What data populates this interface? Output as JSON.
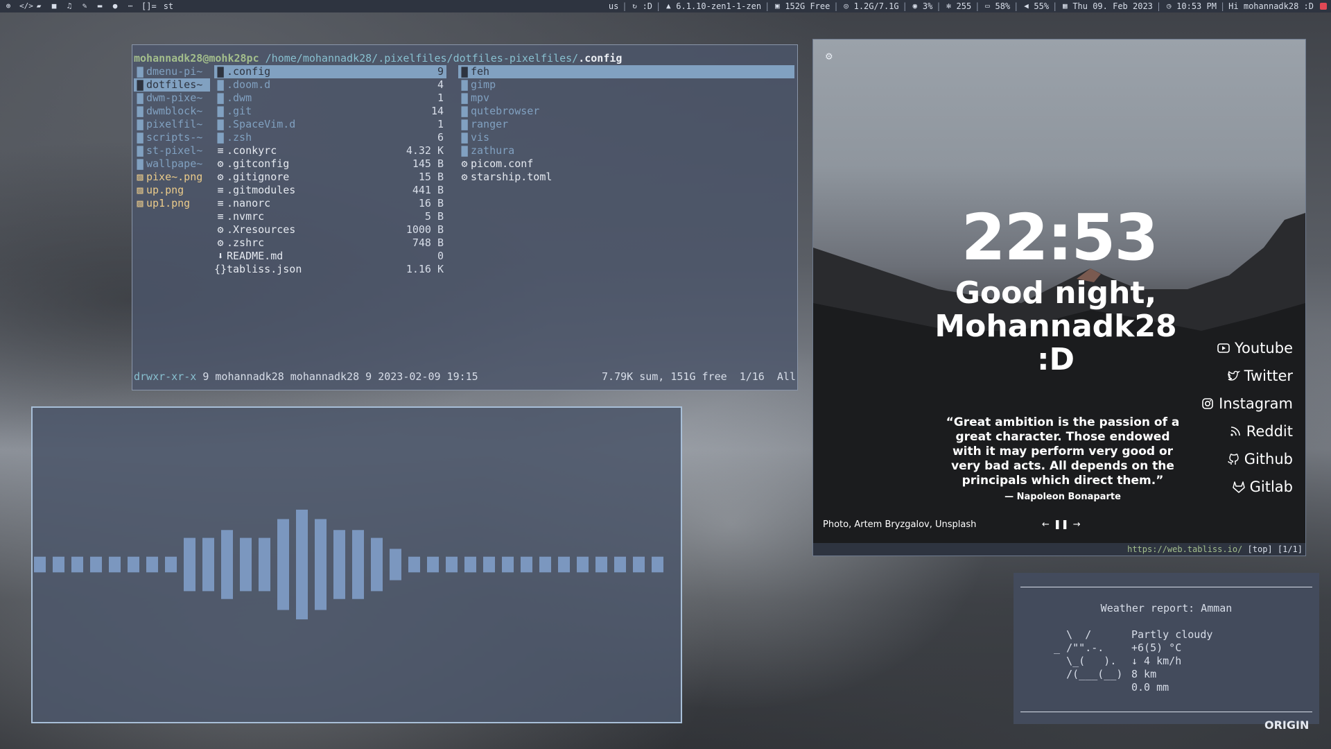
{
  "topbar": {
    "layout": "[]=",
    "title": "st",
    "keyboard": "us",
    "updates": ":D",
    "kernel": "6.1.10-zen1-1-zen",
    "disk": "152G Free",
    "memory": "1.2G/7.1G",
    "cpu": "3%",
    "packages": "255",
    "battery": "58%",
    "volume": "55%",
    "date": "Thu 09. Feb 2023",
    "time": "10:53 PM",
    "greeting": "Hi mohannadk28 :D"
  },
  "ranger": {
    "user_host": "mohannadk28@mohk28pc",
    "path": "/home/mohannadk28/.pixelfiles/dotfiles-pixelfiles/",
    "current": ".config",
    "col1": [
      {
        "name": "dmenu-pi~",
        "type": "dir"
      },
      {
        "name": "dotfiles~",
        "type": "dir",
        "selected": true
      },
      {
        "name": "dwm-pixe~",
        "type": "dir"
      },
      {
        "name": "dwmblock~",
        "type": "dir"
      },
      {
        "name": "pixelfil~",
        "type": "dir"
      },
      {
        "name": "scripts-~",
        "type": "dir"
      },
      {
        "name": "st-pixel~",
        "type": "dir"
      },
      {
        "name": "wallpape~",
        "type": "dir"
      },
      {
        "name": "pixe~.png",
        "type": "img"
      },
      {
        "name": "up.png",
        "type": "img"
      },
      {
        "name": "up1.png",
        "type": "img"
      }
    ],
    "col2": [
      {
        "name": ".config",
        "size": "9",
        "type": "dir",
        "selected": true
      },
      {
        "name": ".doom.d",
        "size": "4",
        "type": "dir"
      },
      {
        "name": ".dwm",
        "size": "1",
        "type": "dir"
      },
      {
        "name": ".git",
        "size": "14",
        "type": "dir"
      },
      {
        "name": ".SpaceVim.d",
        "size": "1",
        "type": "dir"
      },
      {
        "name": ".zsh",
        "size": "6",
        "type": "dir"
      },
      {
        "name": ".conkyrc",
        "size": "4.32 K",
        "type": "file"
      },
      {
        "name": ".gitconfig",
        "size": "145 B",
        "type": "gear"
      },
      {
        "name": ".gitignore",
        "size": "15 B",
        "type": "gear"
      },
      {
        "name": ".gitmodules",
        "size": "441 B",
        "type": "file"
      },
      {
        "name": ".nanorc",
        "size": "16 B",
        "type": "file"
      },
      {
        "name": ".nvmrc",
        "size": "5 B",
        "type": "file"
      },
      {
        "name": ".Xresources",
        "size": "1000 B",
        "type": "gear"
      },
      {
        "name": ".zshrc",
        "size": "748 B",
        "type": "gear"
      },
      {
        "name": "README.md",
        "size": "0",
        "type": "md"
      },
      {
        "name": "tabliss.json",
        "size": "1.16 K",
        "type": "json"
      }
    ],
    "col3": [
      {
        "name": "feh",
        "type": "dir",
        "selected": true
      },
      {
        "name": "gimp",
        "type": "dir"
      },
      {
        "name": "mpv",
        "type": "dir"
      },
      {
        "name": "qutebrowser",
        "type": "dir"
      },
      {
        "name": "ranger",
        "type": "dir"
      },
      {
        "name": "vis",
        "type": "dir"
      },
      {
        "name": "zathura",
        "type": "dir"
      },
      {
        "name": "picom.conf",
        "type": "gear"
      },
      {
        "name": "starship.toml",
        "type": "gear"
      }
    ],
    "status_perm": "drwxr-xr-x",
    "status_info": "9 mohannadk28 mohannadk28 9 2023-02-09 19:15",
    "status_sum": "7.79K sum, 151G free",
    "status_pos": "1/16",
    "status_all": "All"
  },
  "visualizer": {
    "bars": [
      0.1,
      0.1,
      0.1,
      0.1,
      0.1,
      0.1,
      0.1,
      0.1,
      0.34,
      0.34,
      0.44,
      0.34,
      0.34,
      0.58,
      0.7,
      0.58,
      0.44,
      0.44,
      0.34,
      0.2,
      0.1,
      0.1,
      0.1,
      0.1,
      0.1,
      0.1,
      0.1,
      0.1,
      0.1,
      0.1,
      0.1,
      0.1,
      0.1,
      0.1
    ],
    "color": "#7b97bf"
  },
  "browser": {
    "clock": "22:53",
    "greeting": "Good night, Mohannadk28 :D",
    "quote": "“Great ambition is the passion of a great character. Those endowed with it may perform very good or very bad acts. All depends on the principals which direct them.”",
    "quote_author": "— Napoleon Bonaparte",
    "links": [
      "Youtube",
      "Twitter",
      "Instagram",
      "Reddit",
      "Github",
      "Gitlab"
    ],
    "credit": "Photo, Artem Bryzgalov, Unsplash",
    "url": "https://web.tabliss.io/",
    "scroll": "[top] [1/1]"
  },
  "weather": {
    "title": "Weather report: Amman",
    "condition": "Partly cloudy",
    "temp": "+6(5) °C",
    "wind": "↓ 4 km/h",
    "visibility": "8 km",
    "precip": "0.0 mm",
    "art": "    \\  /       \n  _ /\"\".-.     \n    \\_(   ).   \n    /(___(__)  "
  },
  "desktop_logo": "ORIGIN"
}
